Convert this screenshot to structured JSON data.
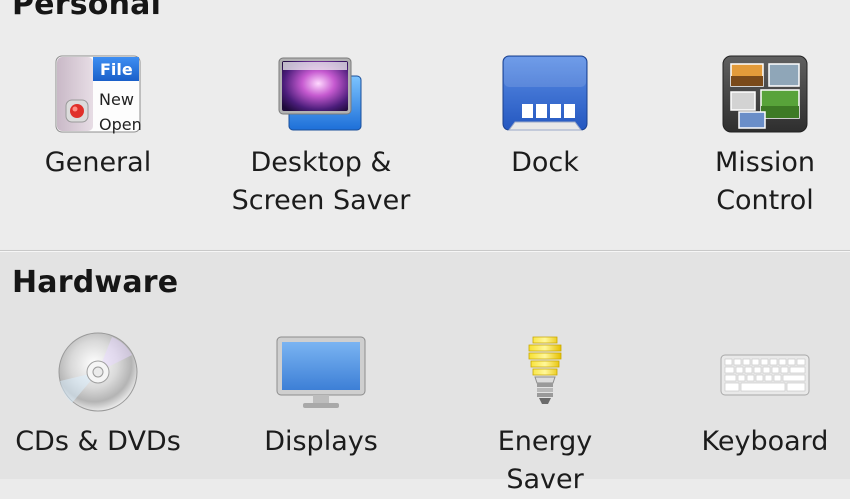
{
  "sections": {
    "personal": {
      "title": "Personal",
      "panes": [
        {
          "id": "general",
          "label": [
            "General"
          ],
          "icon": "general-icon",
          "icon_text": [
            "File",
            "New",
            "Open"
          ]
        },
        {
          "id": "desktop",
          "label": [
            "Desktop &",
            "Screen Saver"
          ],
          "icon": "desktop-screensaver-icon"
        },
        {
          "id": "dock",
          "label": [
            "Dock"
          ],
          "icon": "dock-icon"
        },
        {
          "id": "mission",
          "label": [
            "Mission",
            "Control"
          ],
          "icon": "mission-control-icon"
        }
      ]
    },
    "hardware": {
      "title": "Hardware",
      "panes": [
        {
          "id": "cds",
          "label": [
            "CDs & DVDs"
          ],
          "icon": "cd-dvd-icon"
        },
        {
          "id": "displays",
          "label": [
            "Displays"
          ],
          "icon": "display-icon"
        },
        {
          "id": "energy",
          "label": [
            "Energy",
            "Saver"
          ],
          "icon": "energy-saver-icon"
        },
        {
          "id": "keyboard",
          "label": [
            "Keyboard"
          ],
          "icon": "keyboard-icon"
        }
      ]
    }
  },
  "colors": {
    "background": "#ebebeb",
    "separator": "#c9c9c9",
    "dock_blue": "#3b6fd1",
    "display_blue": "#4c8fe0",
    "bulb_yellow": "#f2d41a"
  }
}
